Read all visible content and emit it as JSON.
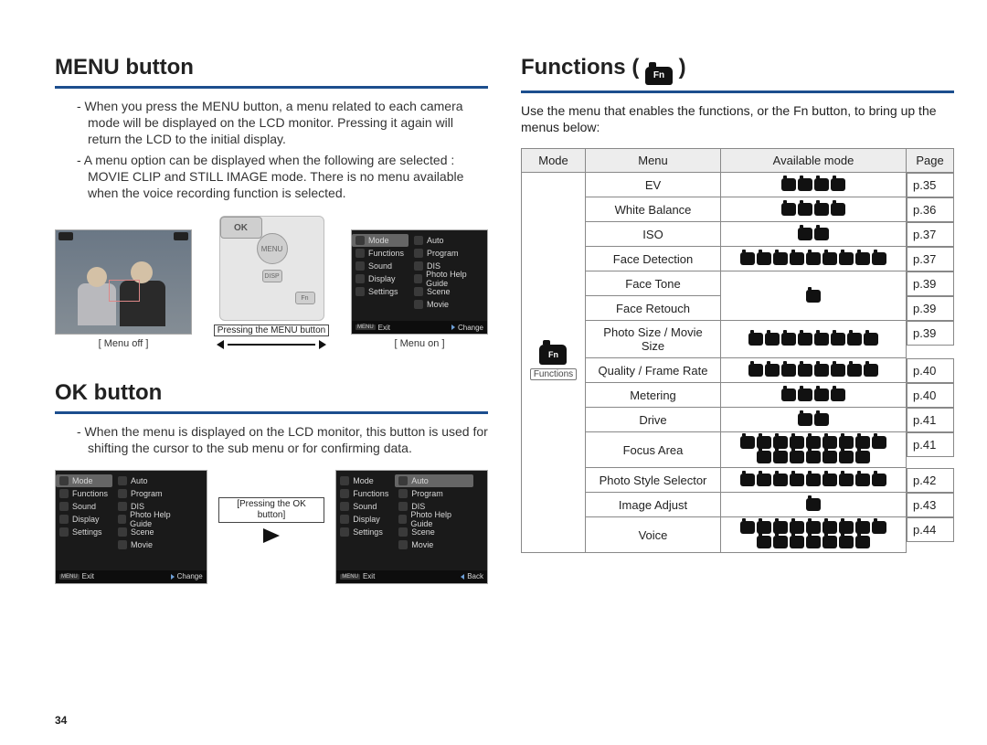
{
  "page_number": "34",
  "left": {
    "menu_button": {
      "heading": "MENU button",
      "para1": "- When you press the MENU button, a menu related to each camera mode will be displayed on the LCD monitor. Pressing it again will return the LCD to the initial display.",
      "para2": "- A menu option can be displayed when the following are selected : MOVIE CLIP and STILL IMAGE mode. There is no menu available when the voice recording function is selected.",
      "caption_off": "[ Menu off ]",
      "midlabel": "Pressing the MENU button",
      "caption_on": "[ Menu on ]",
      "camera_labels": {
        "menu": "MENU",
        "disp": "DISP",
        "ok": "OK",
        "fn": "Fn"
      },
      "menu_items_left": [
        "Mode",
        "Functions",
        "Sound",
        "Display",
        "Settings"
      ],
      "menu_items_right": [
        "Auto",
        "Program",
        "DIS",
        "Photo Help Guide",
        "Scene",
        "Movie"
      ],
      "footer_exit": "Exit",
      "footer_menu_key": "MENU",
      "footer_change": "Change"
    },
    "ok_button": {
      "heading": "OK button",
      "para1": "- When the menu is displayed on the LCD monitor, this button is used for shifting the cursor to the sub menu or for confirming data.",
      "midlabel": "[Pressing the OK button]",
      "footer_back": "Back"
    }
  },
  "right": {
    "heading_prefix": "Functions ( ",
    "heading_suffix": " )",
    "fn_icon_label": "Fn",
    "intro": "Use the menu that enables the functions, or the Fn button, to bring up the menus below:",
    "table": {
      "headers": {
        "mode": "Mode",
        "menu": "Menu",
        "avail": "Available mode",
        "page": "Page"
      },
      "mode_label": "Functions",
      "rows": [
        {
          "menu": "EV",
          "icons": 4,
          "page": "p.35"
        },
        {
          "menu": "White Balance",
          "icons": 4,
          "page": "p.36"
        },
        {
          "menu": "ISO",
          "icons": 2,
          "page": "p.37"
        },
        {
          "menu": "Face Detection",
          "icons": 9,
          "page": "p.37"
        },
        {
          "menu": "Face Tone",
          "icons": 1,
          "page": "p.39",
          "rowspan_avail": 2
        },
        {
          "menu": "Face Retouch",
          "icons": 0,
          "page": "p.39",
          "skip_avail": true
        },
        {
          "menu": "Photo Size / Movie Size",
          "icons": 8,
          "page": "p.39"
        },
        {
          "menu": "Quality / Frame Rate",
          "icons": 8,
          "page": "p.40"
        },
        {
          "menu": "Metering",
          "icons": 4,
          "page": "p.40"
        },
        {
          "menu": "Drive",
          "icons": 2,
          "page": "p.41"
        },
        {
          "menu": "Focus Area",
          "icons": 16,
          "page": "p.41"
        },
        {
          "menu": "Photo Style Selector",
          "icons": 9,
          "page": "p.42"
        },
        {
          "menu": "Image Adjust",
          "icons": 1,
          "page": "p.43"
        },
        {
          "menu": "Voice",
          "icons": 16,
          "page": "p.44"
        }
      ]
    }
  }
}
